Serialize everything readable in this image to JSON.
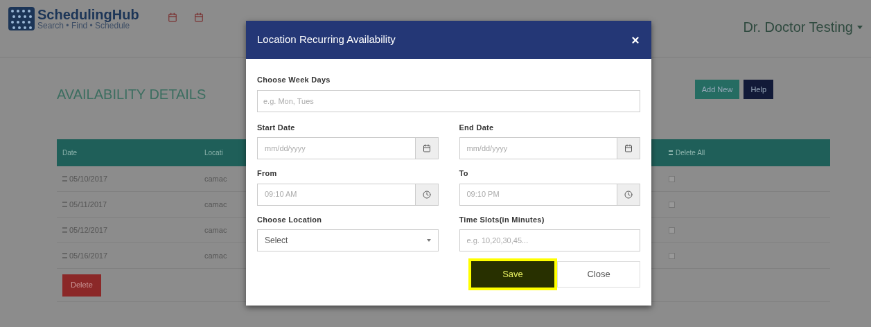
{
  "header": {
    "brand": "SchedulingHub",
    "tagline": "Search • Find • Schedule",
    "user": "Dr. Doctor Testing"
  },
  "page": {
    "title": "AVAILABILITY DETAILS",
    "buttons": [
      {
        "label": "Add New",
        "kind": "primary"
      },
      {
        "label": "Help",
        "kind": "dark"
      }
    ]
  },
  "table": {
    "columns": [
      "Date",
      "Locati",
      "Delete All"
    ],
    "rows": [
      {
        "date": "05/10/2017",
        "location": "camac",
        "checked": false
      },
      {
        "date": "05/11/2017",
        "location": "camac",
        "checked": false
      },
      {
        "date": "05/12/2017",
        "location": "camac",
        "checked": false
      },
      {
        "date": "05/16/2017",
        "location": "camac",
        "checked": false
      }
    ],
    "delete_button": "Delete"
  },
  "modal": {
    "title": "Location Recurring Availability",
    "weekdays": {
      "label": "Choose Week Days",
      "placeholder": "e.g. Mon, Tues"
    },
    "fields": [
      {
        "kind": "date",
        "label": "Start Date",
        "placeholder": "mm/dd/yyyy"
      },
      {
        "kind": "date",
        "label": "End Date",
        "placeholder": "mm/dd/yyyy"
      },
      {
        "kind": "time",
        "label": "From",
        "placeholder": "09:10 AM"
      },
      {
        "kind": "time",
        "label": "To",
        "placeholder": "09:10 PM"
      },
      {
        "kind": "select",
        "label": "Choose Location",
        "value": "Select"
      },
      {
        "kind": "text",
        "label": "Time Slots(in Minutes)",
        "placeholder": "e.g. 10,20,30,45..."
      }
    ],
    "buttons": [
      {
        "label": "Save",
        "kind": "save",
        "highlighted": true
      },
      {
        "label": "Close",
        "kind": "plain",
        "highlighted": false
      }
    ]
  }
}
